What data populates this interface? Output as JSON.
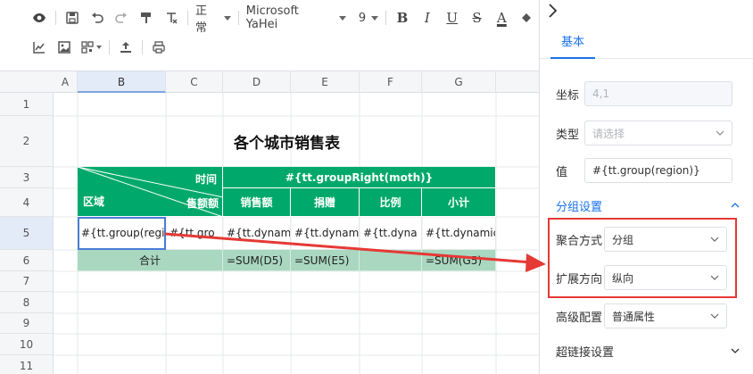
{
  "toolbar": {
    "style_select": "正常",
    "font_select": "Microsoft YaHei",
    "size_select": "9",
    "bold": "B",
    "italic": "I",
    "underline": "U",
    "strike": "S",
    "font_color": "A"
  },
  "grid": {
    "columns": [
      "A",
      "B",
      "C",
      "D",
      "E",
      "F",
      "G"
    ],
    "rows": [
      "1",
      "2",
      "3",
      "4",
      "5",
      "6",
      "7",
      "8",
      "9",
      "10",
      "11"
    ],
    "title": "各个城市销售表",
    "header_time": "时间",
    "header_group_right": "#{tt.groupRight(moth)}",
    "header_region": "区域",
    "header_sales_amount": "售额额",
    "col_sales": "销售额",
    "col_donation": "捐赠",
    "col_ratio": "比例",
    "col_subtotal": "小计",
    "r5_b": "#{tt.group(regi",
    "r5_c": "#{tt.gro",
    "r5_d": "#{tt.dynami",
    "r5_e": "#{tt.dynami",
    "r5_f": "#{tt.dyna",
    "r5_g": "#{tt.dynamic",
    "r6_total": "合计",
    "r6_d": "=SUM(D5)",
    "r6_e": "=SUM(E5)",
    "r6_g": "=SUM(G5)"
  },
  "panel": {
    "tab_basic": "基本",
    "coord_label": "坐标",
    "coord_value": "4,1",
    "type_label": "类型",
    "type_placeholder": "请选择",
    "value_label": "值",
    "value_value": "#{tt.group(region)}",
    "group_section": "分组设置",
    "agg_label": "聚合方式",
    "agg_value": "分组",
    "expand_label": "扩展方向",
    "expand_value": "纵向",
    "advanced_label": "高级配置",
    "advanced_value": "普通属性",
    "hyperlink_section": "超链接设置"
  },
  "colors": {
    "header_green": "#00a96b",
    "total_green": "#a9d7c0",
    "accent_blue": "#1a73e8",
    "highlight_red": "#e53935"
  }
}
